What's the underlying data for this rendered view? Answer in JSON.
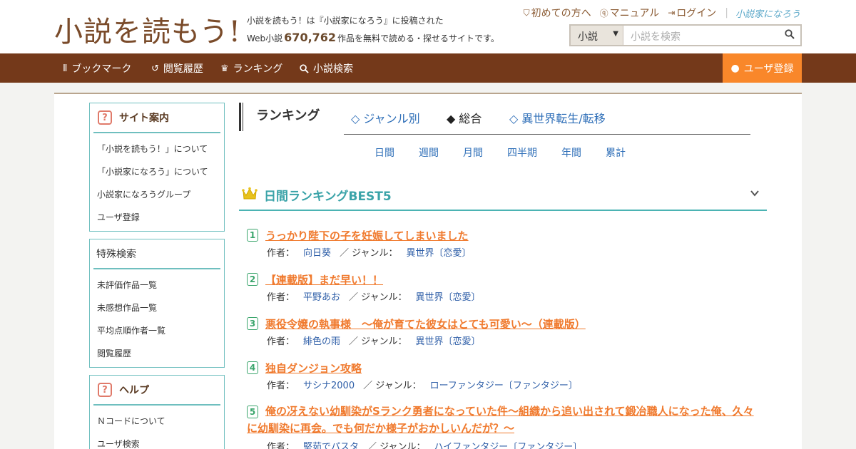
{
  "header": {
    "logo": "小説を読もう!",
    "tagline_1": "小説を読もう！は『小説家になろう』に投稿された",
    "tagline_2_pre": "Web小説",
    "novel_count": "670,762",
    "tagline_2_post": "作品を無料で読める・探せるサイトです。",
    "links": [
      "初めての方へ",
      "マニュアル",
      "ログイン"
    ],
    "partner_logo": "小説家になろう",
    "search": {
      "category": "小説",
      "placeholder": "小説を検索"
    }
  },
  "nav": {
    "items": [
      "ブックマーク",
      "閲覧履歴",
      "ランキング",
      "小説検索"
    ],
    "register": "ユーザ登録"
  },
  "sidebar": {
    "guide": {
      "title": "サイト案内",
      "items": [
        "「小説を読もう！」について",
        "「小説家になろう」について",
        "小説家になろうグループ",
        "ユーザ登録"
      ]
    },
    "special": {
      "title": "特殊検索",
      "items": [
        "未評価作品一覧",
        "未感想作品一覧",
        "平均点順作者一覧",
        "閲覧履歴"
      ]
    },
    "help": {
      "title": "ヘルプ",
      "items": [
        "Ｎコードについて",
        "ユーザ検索"
      ]
    }
  },
  "ranking": {
    "title": "ランキング",
    "tabs": [
      "◇ ジャンル別",
      "◆ 総合",
      "◇ 異世界転生/転移"
    ],
    "periods": [
      "日間",
      "週間",
      "月間",
      "四半期",
      "年間",
      "累計"
    ],
    "best_title": "日間ランキングBEST5",
    "author_label": "作者：",
    "genre_label": "／ ジャンル：",
    "entries": [
      {
        "rank": "1",
        "title": "うっかり陛下の子を妊娠してしまいました",
        "author": "向日葵",
        "genre": "異世界〔恋愛〕"
      },
      {
        "rank": "2",
        "title": "【連載版】まだ早い！！",
        "author": "平野あお",
        "genre": "異世界〔恋愛〕"
      },
      {
        "rank": "3",
        "title": "悪役令嬢の執事様　～俺が育てた彼女はとても可愛い～（連載版）",
        "author": "緋色の雨",
        "genre": "異世界〔恋愛〕"
      },
      {
        "rank": "4",
        "title": "独自ダンジョン攻略",
        "author": "サシナ2000",
        "genre": "ローファンタジー〔ファンタジー〕"
      },
      {
        "rank": "5",
        "title": "俺の冴えない幼馴染がSランク勇者になっていた件～組織から追い出されて鍛冶職人になった俺、久々に幼馴染に再会。でも何だか様子がおかしいんだが？～",
        "author": "堅茹でパスタ",
        "genre": "ハイファンタジー〔ファンタジー〕"
      }
    ]
  },
  "colors": {
    "nav_bg": "#74391a",
    "register_bg": "#f9872a",
    "accent_teal": "#3aa3a8",
    "title_orange": "#f07a2e",
    "link_blue": "#2f6fb8"
  }
}
